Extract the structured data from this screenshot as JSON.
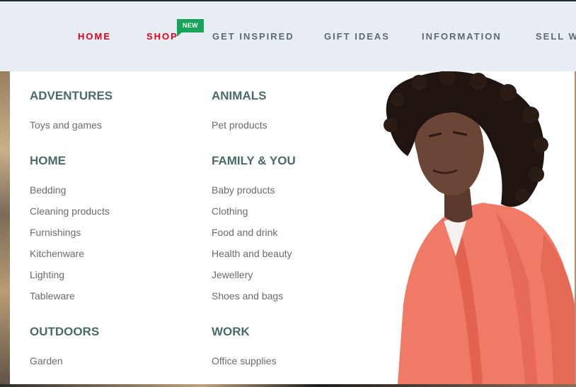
{
  "nav": {
    "items": [
      {
        "label": "HOME",
        "active": true
      },
      {
        "label": "SHOP",
        "active": true
      },
      {
        "label": "GET INSPIRED",
        "active": false
      },
      {
        "label": "GIFT IDEAS",
        "active": false
      },
      {
        "label": "INFORMATION",
        "active": false
      },
      {
        "label": "SELL WI",
        "active": false
      }
    ],
    "badge": "NEW"
  },
  "menu": {
    "left": [
      {
        "heading": "ADVENTURES",
        "links": [
          "Toys and games"
        ]
      },
      {
        "heading": "HOME",
        "links": [
          "Bedding",
          "Cleaning products",
          "Furnishings",
          "Kitchenware",
          "Lighting",
          "Tableware"
        ]
      },
      {
        "heading": "OUTDOORS",
        "links": [
          "Garden"
        ]
      }
    ],
    "right": [
      {
        "heading": "ANIMALS",
        "links": [
          "Pet products"
        ]
      },
      {
        "heading": "FAMILY & YOU",
        "links": [
          "Baby products",
          "Clothing",
          "Food and drink",
          "Health and beauty",
          "Jewellery",
          "Shoes and bags"
        ]
      },
      {
        "heading": "WORK",
        "links": [
          "Office supplies"
        ]
      }
    ]
  },
  "colors": {
    "accent_red": "#e3001b",
    "badge_green": "#17a35a",
    "heading_teal": "#4a6a6a",
    "nav_bg": "#e8edf3"
  }
}
